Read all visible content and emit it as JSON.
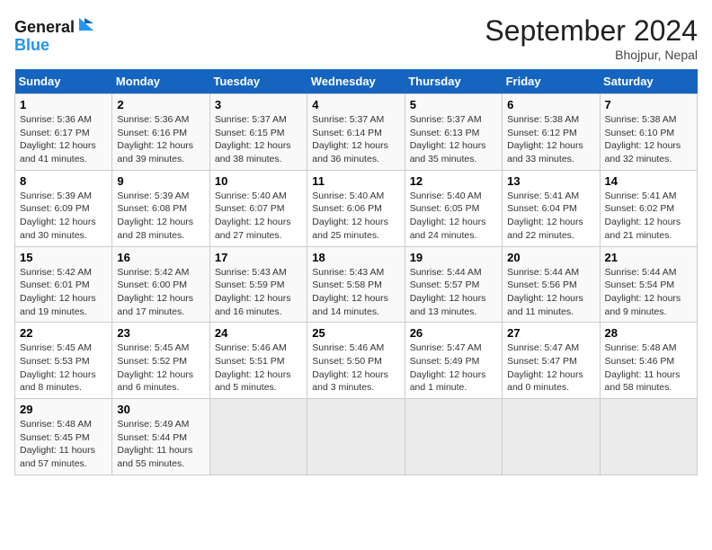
{
  "header": {
    "logo_line1": "General",
    "logo_line2": "Blue",
    "month_title": "September 2024",
    "location": "Bhojpur, Nepal"
  },
  "days_of_week": [
    "Sunday",
    "Monday",
    "Tuesday",
    "Wednesday",
    "Thursday",
    "Friday",
    "Saturday"
  ],
  "weeks": [
    [
      {
        "num": "1",
        "rise": "5:36 AM",
        "set": "6:17 PM",
        "daylight": "12 hours and 41 minutes."
      },
      {
        "num": "2",
        "rise": "5:36 AM",
        "set": "6:16 PM",
        "daylight": "12 hours and 39 minutes."
      },
      {
        "num": "3",
        "rise": "5:37 AM",
        "set": "6:15 PM",
        "daylight": "12 hours and 38 minutes."
      },
      {
        "num": "4",
        "rise": "5:37 AM",
        "set": "6:14 PM",
        "daylight": "12 hours and 36 minutes."
      },
      {
        "num": "5",
        "rise": "5:37 AM",
        "set": "6:13 PM",
        "daylight": "12 hours and 35 minutes."
      },
      {
        "num": "6",
        "rise": "5:38 AM",
        "set": "6:12 PM",
        "daylight": "12 hours and 33 minutes."
      },
      {
        "num": "7",
        "rise": "5:38 AM",
        "set": "6:10 PM",
        "daylight": "12 hours and 32 minutes."
      }
    ],
    [
      {
        "num": "8",
        "rise": "5:39 AM",
        "set": "6:09 PM",
        "daylight": "12 hours and 30 minutes."
      },
      {
        "num": "9",
        "rise": "5:39 AM",
        "set": "6:08 PM",
        "daylight": "12 hours and 28 minutes."
      },
      {
        "num": "10",
        "rise": "5:40 AM",
        "set": "6:07 PM",
        "daylight": "12 hours and 27 minutes."
      },
      {
        "num": "11",
        "rise": "5:40 AM",
        "set": "6:06 PM",
        "daylight": "12 hours and 25 minutes."
      },
      {
        "num": "12",
        "rise": "5:40 AM",
        "set": "6:05 PM",
        "daylight": "12 hours and 24 minutes."
      },
      {
        "num": "13",
        "rise": "5:41 AM",
        "set": "6:04 PM",
        "daylight": "12 hours and 22 minutes."
      },
      {
        "num": "14",
        "rise": "5:41 AM",
        "set": "6:02 PM",
        "daylight": "12 hours and 21 minutes."
      }
    ],
    [
      {
        "num": "15",
        "rise": "5:42 AM",
        "set": "6:01 PM",
        "daylight": "12 hours and 19 minutes."
      },
      {
        "num": "16",
        "rise": "5:42 AM",
        "set": "6:00 PM",
        "daylight": "12 hours and 17 minutes."
      },
      {
        "num": "17",
        "rise": "5:43 AM",
        "set": "5:59 PM",
        "daylight": "12 hours and 16 minutes."
      },
      {
        "num": "18",
        "rise": "5:43 AM",
        "set": "5:58 PM",
        "daylight": "12 hours and 14 minutes."
      },
      {
        "num": "19",
        "rise": "5:44 AM",
        "set": "5:57 PM",
        "daylight": "12 hours and 13 minutes."
      },
      {
        "num": "20",
        "rise": "5:44 AM",
        "set": "5:56 PM",
        "daylight": "12 hours and 11 minutes."
      },
      {
        "num": "21",
        "rise": "5:44 AM",
        "set": "5:54 PM",
        "daylight": "12 hours and 9 minutes."
      }
    ],
    [
      {
        "num": "22",
        "rise": "5:45 AM",
        "set": "5:53 PM",
        "daylight": "12 hours and 8 minutes."
      },
      {
        "num": "23",
        "rise": "5:45 AM",
        "set": "5:52 PM",
        "daylight": "12 hours and 6 minutes."
      },
      {
        "num": "24",
        "rise": "5:46 AM",
        "set": "5:51 PM",
        "daylight": "12 hours and 5 minutes."
      },
      {
        "num": "25",
        "rise": "5:46 AM",
        "set": "5:50 PM",
        "daylight": "12 hours and 3 minutes."
      },
      {
        "num": "26",
        "rise": "5:47 AM",
        "set": "5:49 PM",
        "daylight": "12 hours and 1 minute."
      },
      {
        "num": "27",
        "rise": "5:47 AM",
        "set": "5:47 PM",
        "daylight": "12 hours and 0 minutes."
      },
      {
        "num": "28",
        "rise": "5:48 AM",
        "set": "5:46 PM",
        "daylight": "11 hours and 58 minutes."
      }
    ],
    [
      {
        "num": "29",
        "rise": "5:48 AM",
        "set": "5:45 PM",
        "daylight": "11 hours and 57 minutes."
      },
      {
        "num": "30",
        "rise": "5:49 AM",
        "set": "5:44 PM",
        "daylight": "11 hours and 55 minutes."
      },
      null,
      null,
      null,
      null,
      null
    ]
  ]
}
